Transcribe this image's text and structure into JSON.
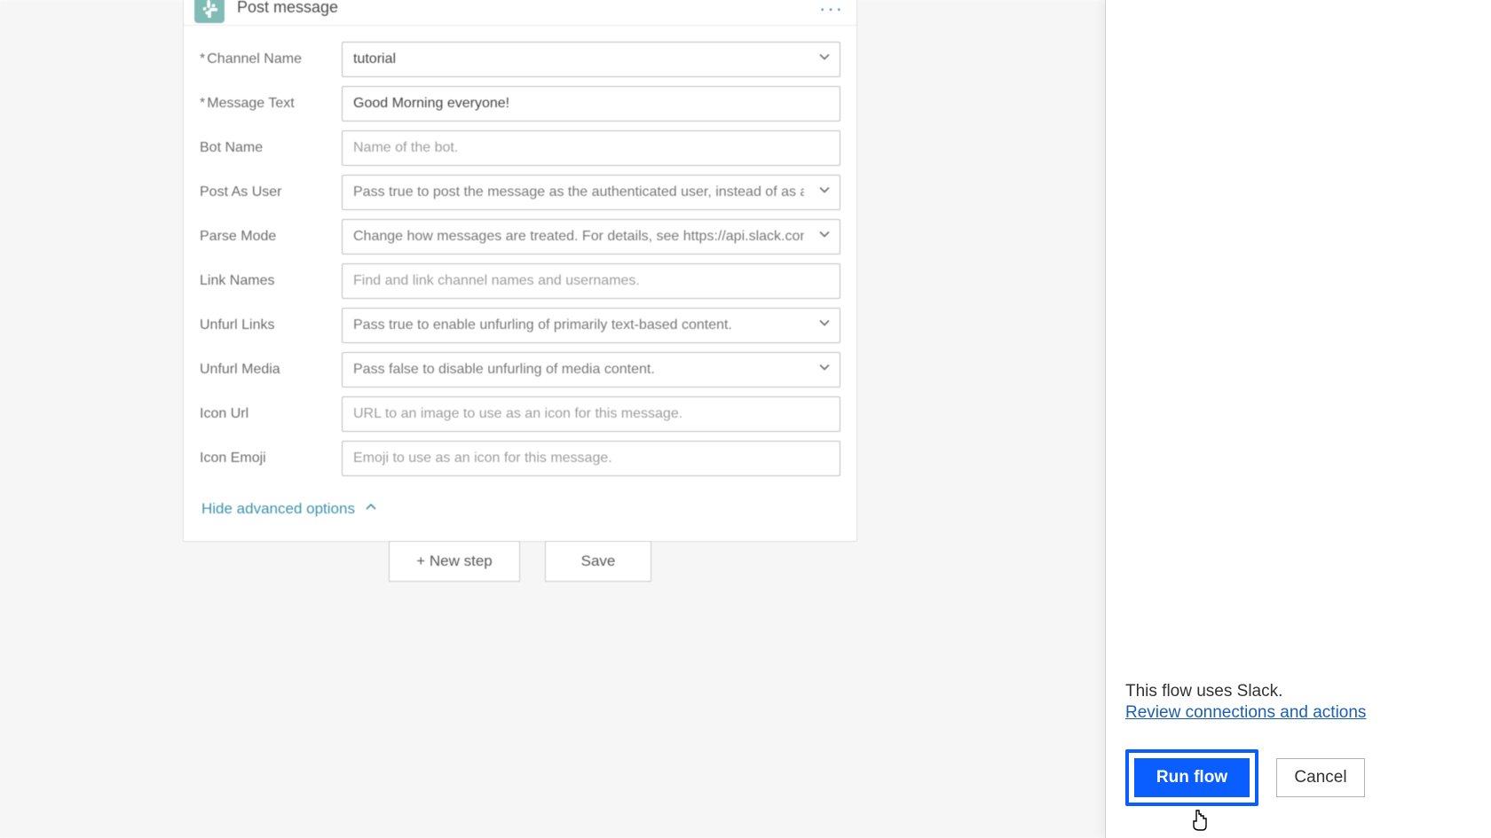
{
  "card": {
    "title": "Post message",
    "hide_advanced": "Hide advanced options"
  },
  "fields": {
    "channel_name": {
      "label": "Channel Name",
      "required": "*",
      "value": "tutorial"
    },
    "message_text": {
      "label": "Message Text",
      "required": "*",
      "value": "Good Morning everyone!"
    },
    "bot_name": {
      "label": "Bot Name",
      "placeholder": "Name of the bot."
    },
    "post_as_user": {
      "label": "Post As User",
      "placeholder": "Pass true to post the message as the authenticated user, instead of as a b"
    },
    "parse_mode": {
      "label": "Parse Mode",
      "placeholder": "Change how messages are treated. For details, see https://api.slack.com/c"
    },
    "link_names": {
      "label": "Link Names",
      "placeholder": "Find and link channel names and usernames."
    },
    "unfurl_links": {
      "label": "Unfurl Links",
      "placeholder": "Pass true to enable unfurling of primarily text-based content."
    },
    "unfurl_media": {
      "label": "Unfurl Media",
      "placeholder": "Pass false to disable unfurling of media content."
    },
    "icon_url": {
      "label": "Icon Url",
      "placeholder": "URL to an image to use as an icon for this message."
    },
    "icon_emoji": {
      "label": "Icon Emoji",
      "placeholder": "Emoji to use as an icon for this message."
    }
  },
  "footer": {
    "new_step": "+ New step",
    "save": "Save"
  },
  "panel": {
    "info": "This flow uses Slack.",
    "review_link": "Review connections and actions",
    "run_flow": "Run flow",
    "cancel": "Cancel"
  }
}
